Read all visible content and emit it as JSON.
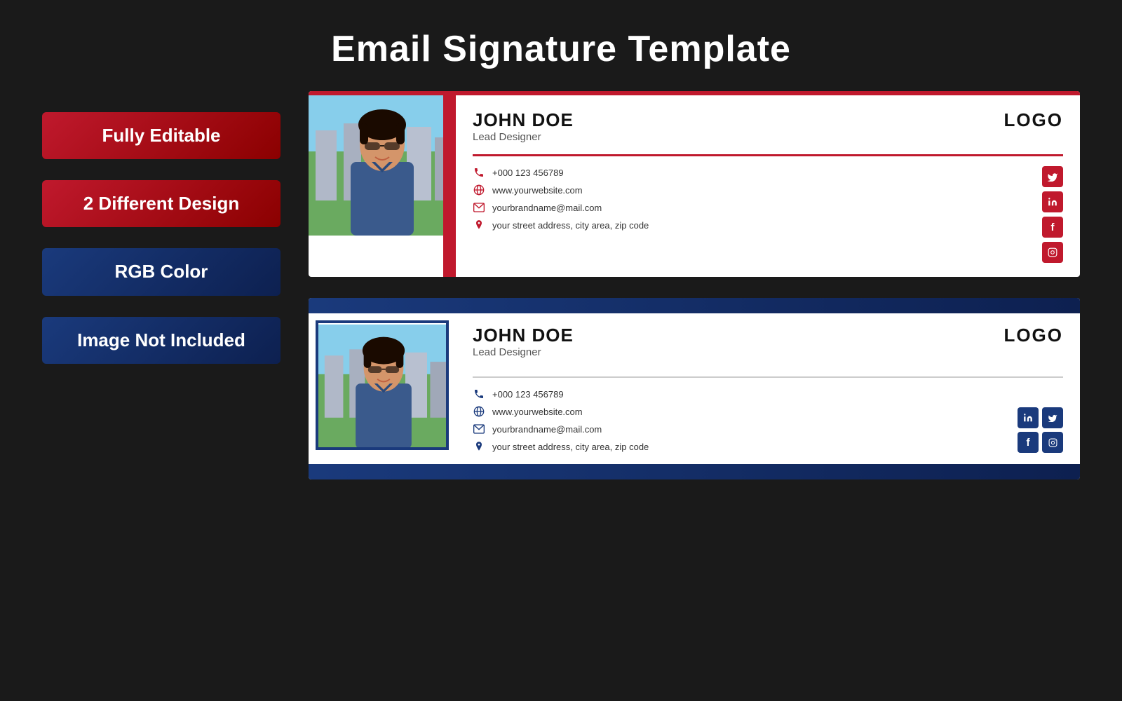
{
  "page": {
    "title": "Email Signature Template",
    "background": "#1a1a1a"
  },
  "badges": [
    {
      "id": "fully-editable",
      "text": "Fully Editable",
      "theme": "red"
    },
    {
      "id": "different-design",
      "text": "2 Different Design",
      "theme": "red"
    },
    {
      "id": "rgb-color",
      "text": "RGB Color",
      "theme": "blue"
    },
    {
      "id": "image-not-included",
      "text": "Image Not Included",
      "theme": "blue"
    }
  ],
  "signature1": {
    "name": "JOHN DOE",
    "title": "Lead Designer",
    "logo": "LOGO",
    "phone": "+000 123 456789",
    "website": "www.yourwebsite.com",
    "email": "yourbrandname@mail.com",
    "address": "your street address, city area, zip code",
    "social": [
      "T",
      "in",
      "f",
      "ig"
    ],
    "theme": "red"
  },
  "signature2": {
    "name": "JOHN DOE",
    "title": "Lead Designer",
    "logo": "LOGO",
    "phone": "+000 123 456789",
    "website": "www.yourwebsite.com",
    "email": "yourbrandname@mail.com",
    "address": "your street address, city area, zip code",
    "social": [
      "in",
      "T",
      "f",
      "ig"
    ],
    "theme": "blue"
  },
  "icons": {
    "phone": "📞",
    "web": "🌐",
    "email": "✉",
    "location": "📍",
    "twitter": "𝕏",
    "linkedin": "in",
    "facebook": "f",
    "instagram": "⊡"
  }
}
